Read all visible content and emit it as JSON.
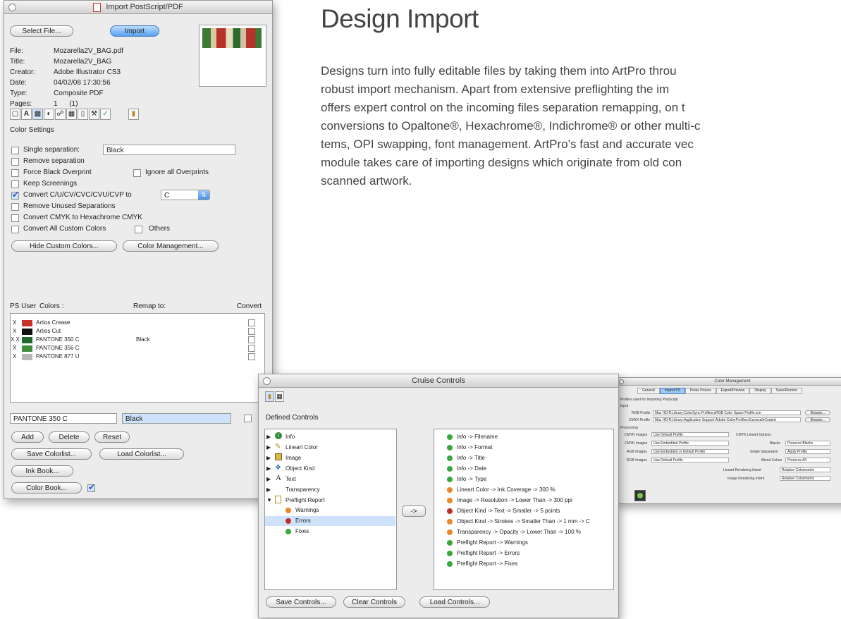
{
  "article": {
    "heading": "Design Import",
    "lines": [
      "Designs turn into fully editable files by taking them into ArtPro throu",
      "robust import mechanism. Apart from extensive preflighting the im",
      "offers expert control on the incoming files separation remapping, on t",
      "conversions to Opaltone®, Hexachrome®, Indichrome® or other multi-c",
      "tems, OPI swapping, font management. ArtPro’s fast and accurate vec",
      "module takes care of importing designs which originate from old con",
      "scanned artwork."
    ]
  },
  "import_window": {
    "title": "Import PostScript/PDF",
    "select_file": "Select File...",
    "import": "Import",
    "info": [
      {
        "key": "File:",
        "value": "Mozarella2V_BAG.pdf"
      },
      {
        "key": "Title:",
        "value": "Mozarella2V_BAG"
      },
      {
        "key": "Creator:",
        "value": "Adobe Illustrator CS3"
      },
      {
        "key": "Date:",
        "value": "04/02/08 17:30:56"
      },
      {
        "key": "Type:",
        "value": "Composite PDF"
      },
      {
        "key": "Pages:",
        "value": "1      (1)"
      }
    ],
    "color_settings": "Color Settings",
    "options": {
      "single_separation": "Single separation:",
      "single_separation_value": "Black",
      "remove_separation": "Remove separation",
      "force_black_overprint": "Force Black Overprint",
      "ignore_all_overprints": "Ignore all Overprints",
      "keep_screenings": "Keep Screenings",
      "convert_c": "Convert C/U/CV/CVC/CVU/CVP to",
      "convert_c_value": "C",
      "remove_unused": "Remove Unused Separations",
      "convert_cmyk": "Convert CMYK to Hexachrome CMYK",
      "convert_all_custom": "Convert All Custom Colors",
      "others": "Others"
    },
    "hide_custom_colors": "Hide Custom Colors...",
    "color_management": "Color Management...",
    "table_headers": {
      "ps_user": "PS User",
      "colors": "Colors :",
      "remap": "Remap to:",
      "convert": "Convert"
    },
    "colors": [
      {
        "mark": "X",
        "swatch": "#c8322a",
        "name": "Artios Crease",
        "remap": ""
      },
      {
        "mark": "X",
        "swatch": "#111111",
        "name": "Artios Cut",
        "remap": ""
      },
      {
        "mark": "X X",
        "swatch": "#1d6a2a",
        "name": "PANTONE 350 C",
        "remap": "Black"
      },
      {
        "mark": "X",
        "swatch": "#3f8f3a",
        "name": "PANTONE 356 C",
        "remap": ""
      },
      {
        "mark": "X",
        "swatch": "#b8b8b8",
        "name": "PANTONE 877 U",
        "remap": ""
      }
    ],
    "selected_color": "PANTONE 350 C",
    "selected_remap": "Black",
    "add": "Add",
    "delete": "Delete",
    "reset": "Reset",
    "save_colorlist": "Save Colorlist...",
    "load_colorlist": "Load Colorlist...",
    "ink_book": "Ink Book...",
    "color_book": "Color Book..."
  },
  "cruise_window": {
    "title": "Cruise Controls",
    "defined_controls": "Defined Controls",
    "tree": [
      {
        "label": "Info",
        "arrow": "▶",
        "indent": 0
      },
      {
        "label": "Lineart Color",
        "arrow": "▶",
        "indent": 0
      },
      {
        "label": "Image",
        "arrow": "▶",
        "indent": 0
      },
      {
        "label": "Object Kind",
        "arrow": "▶",
        "indent": 0
      },
      {
        "label": "Text",
        "arrow": "▶",
        "indent": 0
      },
      {
        "label": "Transparency",
        "arrow": "▶",
        "indent": 0
      },
      {
        "label": "Preflight Report",
        "arrow": "▼",
        "indent": 0
      },
      {
        "label": "Warnings",
        "arrow": "",
        "indent": 1,
        "dot": "#e8892a"
      },
      {
        "label": "Errors",
        "arrow": "",
        "indent": 1,
        "dot": "#c0302a",
        "selected": true
      },
      {
        "label": "Fixes",
        "arrow": "",
        "indent": 1,
        "dot": "#3aa83a"
      }
    ],
    "move_button": "->",
    "rules": [
      {
        "dot": "#3aa83a",
        "text": "Info -> Filename"
      },
      {
        "dot": "#3aa83a",
        "text": "Info -> Format"
      },
      {
        "dot": "#3aa83a",
        "text": "Info -> Title"
      },
      {
        "dot": "#3aa83a",
        "text": "Info -> Date"
      },
      {
        "dot": "#3aa83a",
        "text": "Info -> Type"
      },
      {
        "dot": "#e8892a",
        "text": "Lineart Color -> Ink Coverage -> 300 %"
      },
      {
        "dot": "#e8892a",
        "text": "Image -> Resolution -> Lower Than -> 300 ppi"
      },
      {
        "dot": "#c0302a",
        "text": "Object Kind -> Text -> Smaller -> 5 points"
      },
      {
        "dot": "#e8892a",
        "text": "Object Kind -> Strokes -> Smaller Than -> 1 mm -> C"
      },
      {
        "dot": "#e8892a",
        "text": "Transparency -> Opacity -> Lower Than -> 100 %"
      },
      {
        "dot": "#3aa83a",
        "text": "Preflight Report -> Warnings"
      },
      {
        "dot": "#3aa83a",
        "text": "Preflight Report -> Errors"
      },
      {
        "dot": "#3aa83a",
        "text": "Preflight Report -> Fixes"
      }
    ],
    "save_controls": "Save Controls...",
    "clear_controls": "Clear Controls",
    "load_controls": "Load Controls..."
  },
  "cm_window": {
    "title": "Color Management",
    "tabs": [
      "General",
      "Import PS",
      "Press Proves",
      "Export/Preview",
      "Display",
      "Save/Restore"
    ],
    "active_tab": 1,
    "section_label": "Profiles used for Importing Postscript",
    "input_label": "Input",
    "rgb_profile_label": "RGB Profile",
    "rgb_profile_value": "Mac HD:R:Library:ColorSync:Profiles:sRGB Color Space Profile.icm",
    "cmyk_profile_label": "CMYK Profile",
    "cmyk_profile_value": "Mac HD:R:Library:Application Support:Adobe:Color:Profiles:EuroscaleCoated",
    "browse": "Browse...",
    "processing_label": "Processing",
    "processing_left": [
      {
        "label": "CMYK Images",
        "value": "Use Default Profile"
      },
      {
        "label": "CMYK Images",
        "value": "Use Embedded Profile"
      },
      {
        "label": "RGB Images",
        "value": "Use Embedded or Default Profile"
      },
      {
        "label": "RGB Images",
        "value": "Use Default Profile"
      }
    ],
    "cmyk_lineart_options": "CMYK Lineart Options",
    "processing_right": [
      {
        "label": "Blacks",
        "value": "Preserve Blacks"
      },
      {
        "label": "Single Separation",
        "value": "Apply Profile"
      },
      {
        "label": "Mixed Colors",
        "value": "Preserve All"
      }
    ],
    "lineart_intent_label": "Lineart Rendering Intent",
    "lineart_intent_value": "Relative Colorimetric",
    "image_intent_label": "Image Rendering Intent",
    "image_intent_value": "Relative Colorimetric"
  },
  "colors": {
    "accent": "#5aa2f0",
    "selection": "#cfe2fb",
    "text": "#444444"
  }
}
